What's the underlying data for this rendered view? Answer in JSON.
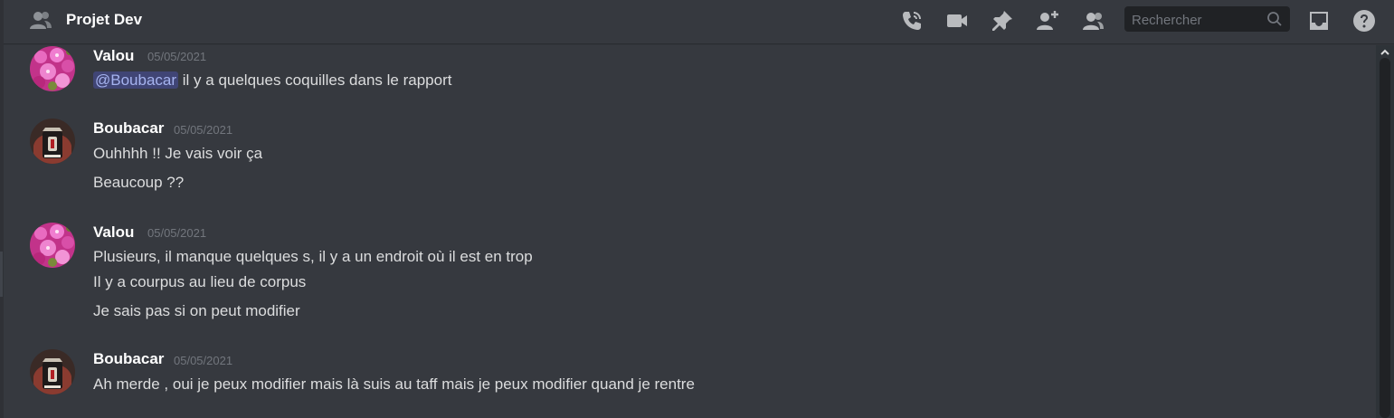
{
  "header": {
    "channel_title": "Projet Dev",
    "search_placeholder": "Rechercher"
  },
  "icons": {
    "channel": "group-icon",
    "call": "voice-call-icon",
    "video": "video-call-icon",
    "pin": "pin-icon",
    "add_member": "add-member-icon",
    "members": "member-list-icon",
    "search": "search-icon",
    "inbox": "inbox-icon",
    "help": "help-icon"
  },
  "colors": {
    "background": "#36393f",
    "mention_text": "#a5b3ef",
    "username": "#ffffff",
    "timestamp": "#72767d"
  },
  "messages": [
    {
      "author": "Valou",
      "timestamp": "05/05/2021",
      "mention": "@Boubacar",
      "lines": [
        "il y a quelques coquilles dans le rapport"
      ]
    },
    {
      "author": "Boubacar",
      "timestamp": "05/05/2021",
      "lines": [
        "Ouhhhh !! Je vais voir ça",
        "Beaucoup ??"
      ]
    },
    {
      "author": "Valou",
      "timestamp": "05/05/2021",
      "lines": [
        "Plusieurs, il manque quelques s, il y a un endroit où il est en trop",
        "Il y a courpus au lieu de corpus",
        "Je sais pas si on peut modifier"
      ]
    },
    {
      "author": "Boubacar",
      "timestamp": "05/05/2021",
      "lines": [
        "Ah merde , oui je peux modifier mais là suis au taff mais je peux modifier quand je rentre"
      ]
    }
  ]
}
